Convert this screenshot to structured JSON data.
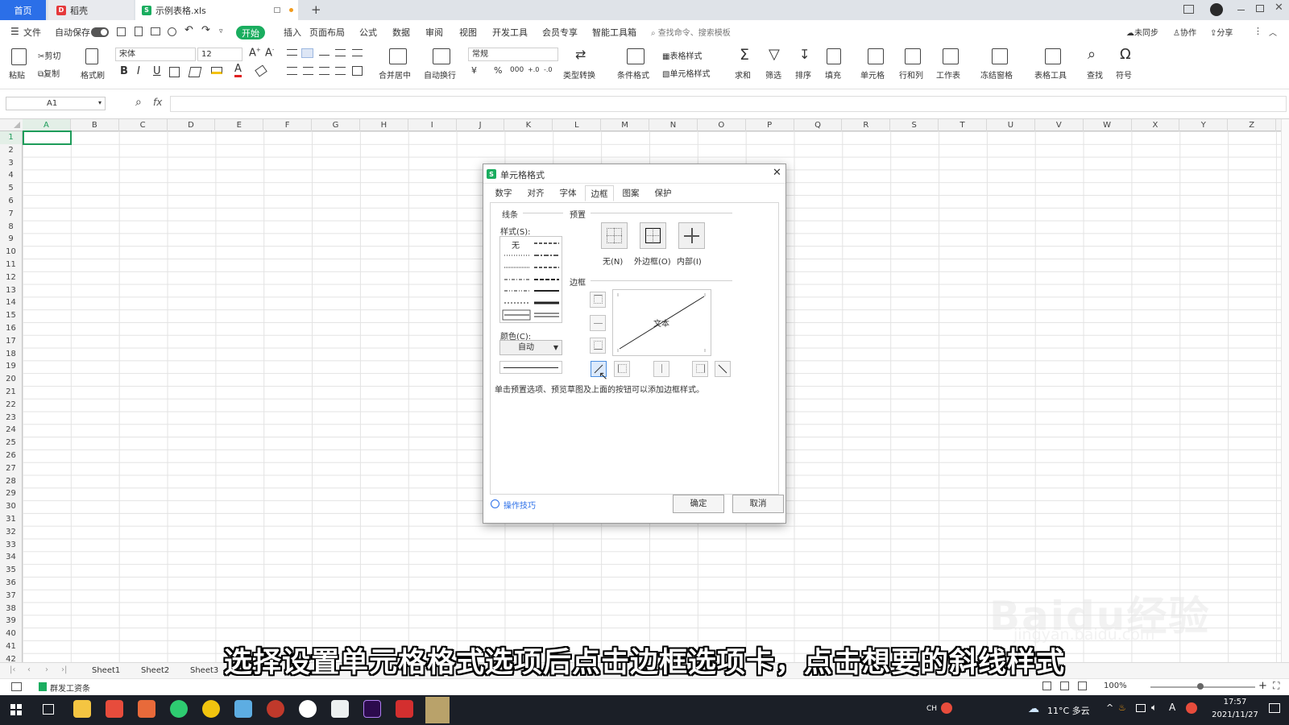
{
  "tabs": {
    "home": "首页",
    "daoke": "稻壳",
    "file": "示例表格.xls",
    "new_tab": "+"
  },
  "menu": {
    "file": "文件",
    "autosave": "自动保存",
    "start": "开始",
    "items": [
      "插入",
      "页面布局",
      "公式",
      "数据",
      "审阅",
      "视图",
      "开发工具",
      "会员专享",
      "智能工具箱"
    ],
    "search": "查找命令、搜索模板",
    "sync": "未同步",
    "collab": "协作",
    "share": "分享"
  },
  "ribbon": {
    "paste": "粘贴",
    "cut": "剪切",
    "copy": "复制",
    "format_painter": "格式刷",
    "font": "宋体",
    "font_size": "12",
    "bold": "B",
    "italic": "I",
    "underline": "U",
    "merge": "合并居中",
    "wrap": "自动换行",
    "number_format": "常规",
    "currency": "¥",
    "percent": "%",
    "thousands": "000",
    "type_convert": "类型转换",
    "cond_format": "条件格式",
    "table_style": "表格样式",
    "cell_style": "单元格样式",
    "sum": "求和",
    "filter": "筛选",
    "sort": "排序",
    "fill": "填充",
    "cell": "单元格",
    "rowcol": "行和列",
    "worksheet": "工作表",
    "freeze": "冻结窗格",
    "table_tools": "表格工具",
    "find": "查找",
    "symbol": "符号"
  },
  "formula_bar": {
    "name_box": "A1",
    "fx": "fx"
  },
  "columns": [
    "A",
    "B",
    "C",
    "D",
    "E",
    "F",
    "G",
    "H",
    "I",
    "J",
    "K",
    "L",
    "M",
    "N",
    "O",
    "P",
    "Q",
    "R",
    "S",
    "T",
    "U",
    "V",
    "W",
    "X",
    "Y",
    "Z"
  ],
  "rows": [
    "1",
    "2",
    "3",
    "4",
    "5",
    "6",
    "7",
    "8",
    "9",
    "10",
    "11",
    "12",
    "13",
    "14",
    "15",
    "16",
    "17",
    "18",
    "19",
    "20",
    "21",
    "22",
    "23",
    "24",
    "25",
    "26",
    "27",
    "28",
    "29",
    "30",
    "31",
    "32",
    "33",
    "34",
    "35",
    "36",
    "37",
    "38",
    "39",
    "40",
    "41",
    "42"
  ],
  "sheets": [
    "Sheet1",
    "Sheet2",
    "Sheet3",
    "Sh"
  ],
  "status": {
    "workgroup": "群发工资条",
    "zoom": "100%"
  },
  "taskbar": {
    "lang": "CH",
    "weather": "11°C 多云",
    "ime": "A",
    "time": "17:57",
    "date": "2021/11/27"
  },
  "dialog": {
    "title": "单元格格式",
    "tabs": [
      "数字",
      "对齐",
      "字体",
      "边框",
      "图案",
      "保护"
    ],
    "active_tab": "边框",
    "line_section": "线条",
    "style_label": "样式(S):",
    "style_none": "无",
    "color_label": "颜色(C):",
    "color_value": "自动",
    "preset_section": "预置",
    "presets": [
      "无(N)",
      "外边框(O)",
      "内部(I)"
    ],
    "border_section": "边框",
    "preview_text": "文本",
    "hint": "单击预置选项、预览草图及上面的按钮可以添加边框样式。",
    "tips": "操作技巧",
    "ok": "确定",
    "cancel": "取消"
  },
  "subtitle": "选择设置单元格格式选项后点击边框选项卡，点击想要的斜线样式",
  "watermark": "Baidu经验",
  "watermark_url": "jingyan.baidu.com",
  "accent_color": "#1aad5f"
}
